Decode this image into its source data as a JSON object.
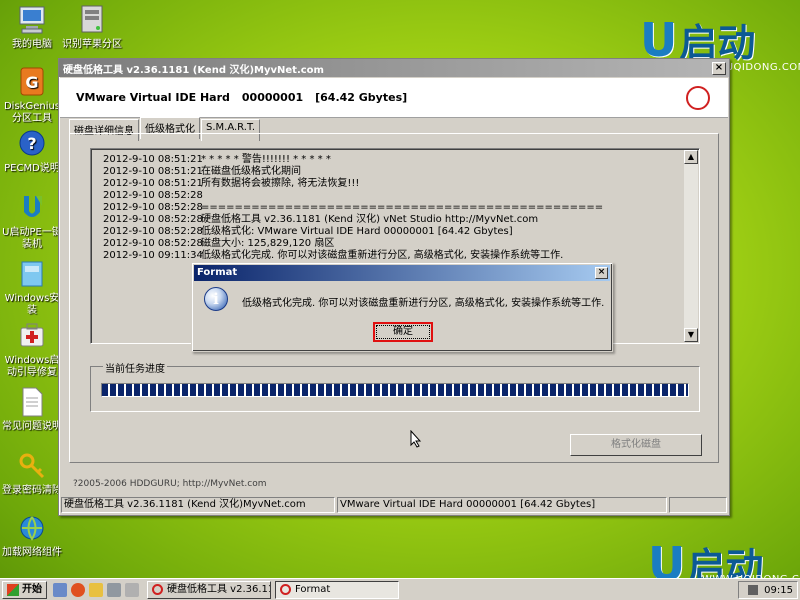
{
  "desktop": {
    "icons": [
      {
        "label": "我的电脑",
        "icon": "computer-icon"
      },
      {
        "label": "识别苹果分区",
        "icon": "drive-icon"
      },
      {
        "label": "DiskGenius分区工具",
        "icon": "diskgenius-icon"
      },
      {
        "label": "PECMD说明",
        "icon": "help-icon"
      },
      {
        "label": "U启动PE一键装机",
        "icon": "u-logo-icon"
      },
      {
        "label": "Windows安装",
        "icon": "windows-install-icon"
      },
      {
        "label": "Windows启动引导修复",
        "icon": "repair-icon"
      },
      {
        "label": "常见问题说明",
        "icon": "document-icon"
      },
      {
        "label": "登录密码清除",
        "icon": "key-icon"
      },
      {
        "label": "加载网络组件",
        "icon": "network-icon"
      }
    ],
    "logo_text": "启动",
    "logo_url": "WWW.UQIDONG.COM"
  },
  "window": {
    "title": "硬盘低格工具 v2.36.1181 (Kend 汉化)MyvNet.com",
    "drive_model": "VMware Virtual IDE Hard",
    "drive_serial": "00000001",
    "drive_size": "[64.42 Gbytes]",
    "tabs": [
      {
        "label": "磁盘详细信息",
        "active": false
      },
      {
        "label": "低级格式化",
        "active": true
      },
      {
        "label": "S.M.A.R.T.",
        "active": false
      }
    ],
    "log": [
      {
        "ts": "2012-9-10 08:51:21",
        "msg": "* * * * *  警告!!!!!!! * * * * *"
      },
      {
        "ts": "2012-9-10 08:51:21",
        "msg": "在磁盘低级格式化期间"
      },
      {
        "ts": "2012-9-10 08:51:21",
        "msg": "所有数据将会被擦除, 将无法恢复!!!"
      },
      {
        "ts": "2012-9-10 08:52:28",
        "msg": ""
      },
      {
        "ts": "2012-9-10 08:52:28",
        "msg": "================================================"
      },
      {
        "ts": "2012-9-10 08:52:28",
        "msg": "硬盘低格工具 v2.36.1181 (Kend 汉化) vNet Studio http://MyvNet.com"
      },
      {
        "ts": "2012-9-10 08:52:28",
        "msg": "低级格式化:      VMware Virtual IDE Hard    00000001    [64.42 Gbytes]"
      },
      {
        "ts": "2012-9-10 08:52:28",
        "msg": "磁盘大小:    125,829,120 扇区"
      },
      {
        "ts": "2012-9-10 09:11:34",
        "msg": "低级格式化完成. 你可以对该磁盘重新进行分区, 高级格式化, 安装操作系统等工作."
      }
    ],
    "progress_label": "当前任务进度",
    "progress": 1.0,
    "format_button": "格式化磁盘",
    "copyright": "?2005-2006 HDDGURU;  http://MyvNet.com",
    "status": [
      "硬盘低格工具 v2.36.1181 (Kend 汉化)MyvNet.com",
      "VMware Virtual IDE Hard    00000001    [64.42 Gbytes]"
    ]
  },
  "dialog": {
    "title": "Format",
    "message": "低级格式化完成. 你可以对该磁盘重新进行分区, 高级格式化, 安装操作系统等工作.",
    "ok_label": "确定"
  },
  "taskbar": {
    "start_label": "开始",
    "tasks": [
      {
        "label": "硬盘低格工具 v2.36.11...",
        "pressed": false
      },
      {
        "label": "Format",
        "pressed": true
      }
    ],
    "clock": "09:15"
  },
  "colors": {
    "dialog_title": "#0a246a",
    "progress_fill": "#0a246a",
    "ok_highlight": "#e01010",
    "logo_blue": "#1b7dc2"
  }
}
